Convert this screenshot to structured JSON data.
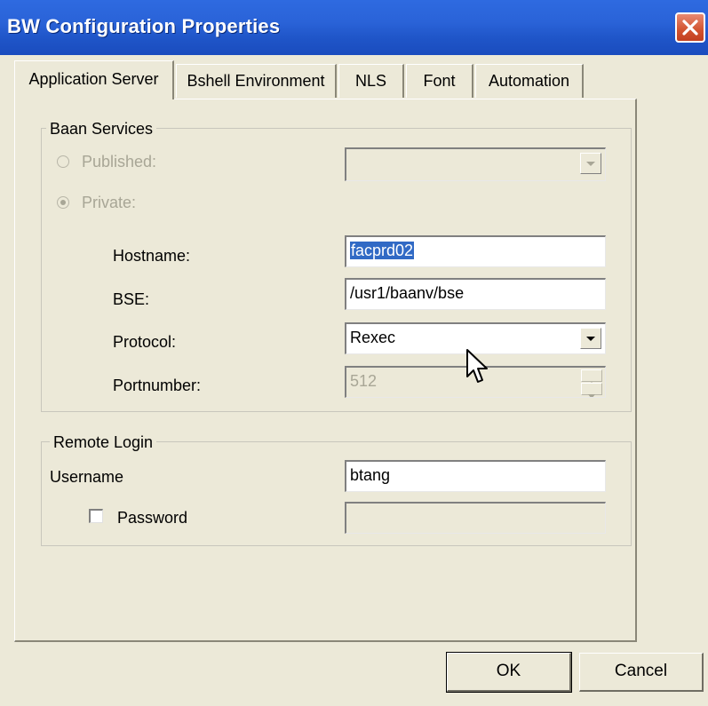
{
  "window": {
    "title": "BW Configuration Properties"
  },
  "tabs": [
    {
      "label": "Application Server",
      "active": true
    },
    {
      "label": "Bshell Environment",
      "active": false
    },
    {
      "label": "NLS",
      "active": false
    },
    {
      "label": "Font",
      "active": false
    },
    {
      "label": "Automation",
      "active": false
    }
  ],
  "baan_services": {
    "title": "Baan Services",
    "published_label": "Published:",
    "private_label": "Private:",
    "published_value": "",
    "hostname_label": "Hostname:",
    "hostname_value": "facprd02",
    "bse_label": "BSE:",
    "bse_value": "/usr1/baanv/bse",
    "protocol_label": "Protocol:",
    "protocol_value": "Rexec",
    "portnumber_label": "Portnumber:",
    "portnumber_value": "512"
  },
  "remote_login": {
    "title": "Remote Login",
    "username_label": "Username",
    "username_value": "btang",
    "password_label": "Password",
    "password_value": ""
  },
  "buttons": {
    "ok": "OK",
    "cancel": "Cancel"
  },
  "icons": {
    "close": "close-icon",
    "dropdown": "chevron-down-icon",
    "spin_up": "spin-up-icon",
    "spin_down": "spin-down-icon",
    "cursor": "mouse-pointer-icon"
  },
  "colors": {
    "titlebar": "#2a63d8",
    "selection": "#316ac5",
    "dialog_bg": "#ece9d8",
    "close_button": "#d2532f"
  }
}
